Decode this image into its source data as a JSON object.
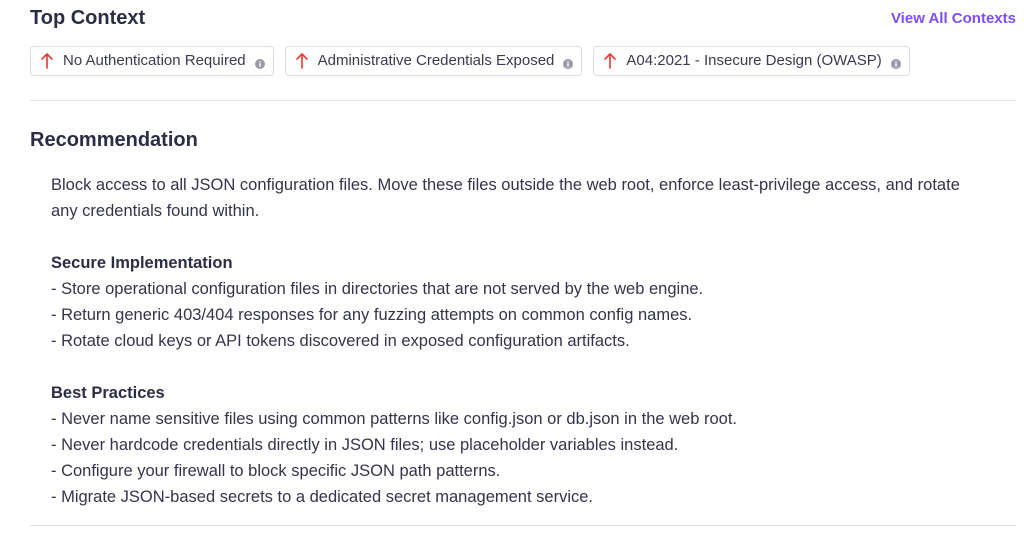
{
  "context": {
    "title": "Top Context",
    "view_all_label": "View All Contexts",
    "chips": [
      {
        "label": "No Authentication Required",
        "arrow_icon": "arrow-up-icon",
        "info_icon": "info-icon"
      },
      {
        "label": "Administrative Credentials Exposed",
        "arrow_icon": "arrow-up-icon",
        "info_icon": "info-icon"
      },
      {
        "label": "A04:2021 - Insecure Design (OWASP)",
        "arrow_icon": "arrow-up-icon",
        "info_icon": "info-icon"
      }
    ]
  },
  "recommendation": {
    "title": "Recommendation",
    "summary": "Block access to all JSON configuration files. Move these files outside the web root, enforce least-privilege access, and rotate any credentials found within.",
    "sections": [
      {
        "title": "Secure Implementation",
        "items": [
          "- Store operational configuration files in directories that are not served by the web engine.",
          "- Return generic 403/404 responses for any fuzzing attempts on common config names.",
          "- Rotate cloud keys or API tokens discovered in exposed configuration artifacts."
        ]
      },
      {
        "title": "Best Practices",
        "items": [
          "- Never name sensitive files using common patterns like config.json or db.json in the web root.",
          "- Never hardcode credentials directly in JSON files; use placeholder variables instead.",
          "- Configure your firewall to block specific JSON path patterns.",
          "- Migrate JSON-based secrets to a dedicated secret management service."
        ]
      }
    ]
  },
  "colors": {
    "accent": "#7c4dff",
    "arrow": "#e53935",
    "info": "#9a9aa8",
    "text": "#34344a",
    "divider": "#e1e1e8"
  }
}
